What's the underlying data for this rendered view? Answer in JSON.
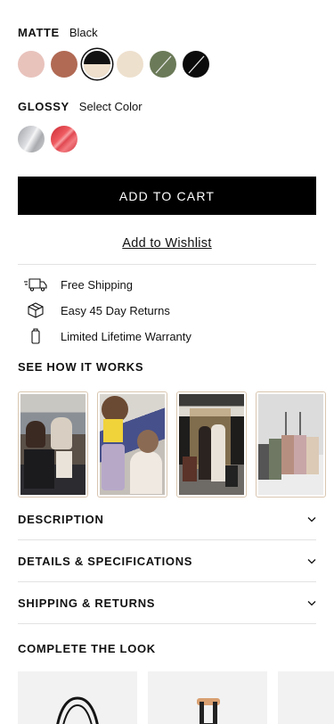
{
  "matte": {
    "label": "MATTE",
    "selected_value": "Black",
    "swatches": [
      {
        "name": "blush pink",
        "color": "#e8c3bc"
      },
      {
        "name": "terracotta",
        "color": "#b16a54"
      },
      {
        "name": "black/cream",
        "color": "#111111",
        "selected": true
      },
      {
        "name": "cream",
        "color": "#ede0cd"
      },
      {
        "name": "olive",
        "color": "#6b7a58"
      },
      {
        "name": "black",
        "color": "#0b0b0b"
      }
    ]
  },
  "glossy": {
    "label": "GLOSSY",
    "selected_value": "Select Color",
    "swatches": [
      {
        "name": "silver",
        "color": "#b8b9bd"
      },
      {
        "name": "red",
        "color": "#dd3d46"
      }
    ]
  },
  "actions": {
    "add_to_cart": "ADD TO CART",
    "wishlist": "Add to Wishlist"
  },
  "features": [
    {
      "icon": "truck-icon",
      "text": "Free Shipping"
    },
    {
      "icon": "box-icon",
      "text": "Easy 45 Day Returns"
    },
    {
      "icon": "luggage-icon",
      "text": "Limited Lifetime Warranty"
    }
  ],
  "how_it_works": {
    "title": "SEE HOW IT WORKS",
    "videos": [
      {
        "name": "airport-lounge-video"
      },
      {
        "name": "plane-aisle-video"
      },
      {
        "name": "hotel-elevator-video"
      },
      {
        "name": "luggage-lineup-video"
      }
    ]
  },
  "accordions": [
    {
      "title": "DESCRIPTION"
    },
    {
      "title": "DETAILS & SPECIFICATIONS"
    },
    {
      "title": "SHIPPING & RETURNS"
    }
  ],
  "complete_look": {
    "title": "COMPLETE THE LOOK"
  }
}
